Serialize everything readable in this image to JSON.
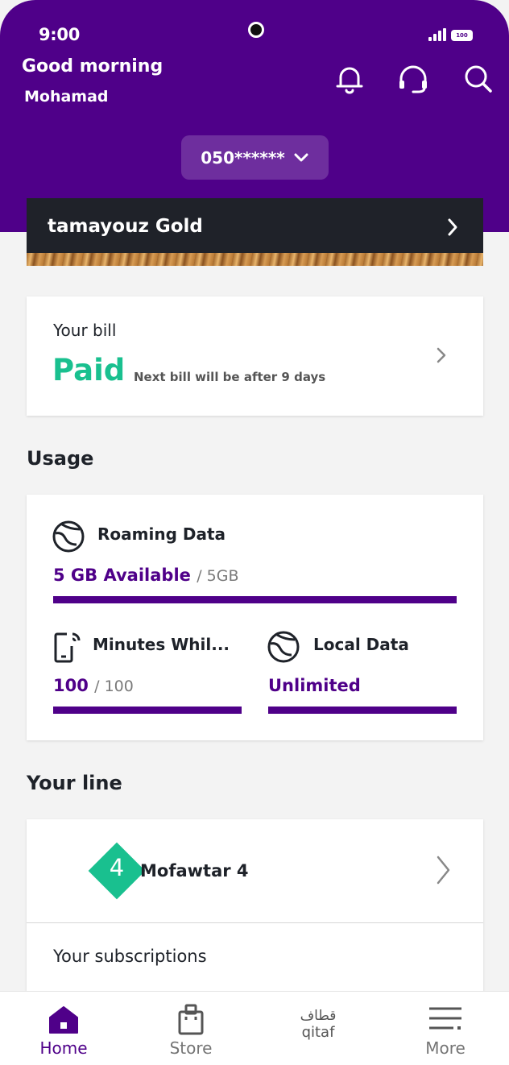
{
  "status_bar": {
    "time": "9:00",
    "battery": "100"
  },
  "header": {
    "greeting": "Good morning",
    "user_name": "Mohamad",
    "phone_number": "050******"
  },
  "tier": {
    "label": "tamayouz Gold"
  },
  "bill": {
    "title": "Your bill",
    "status": "Paid",
    "next_bill_note": "Next bill will be after 9 days"
  },
  "usage": {
    "section_title": "Usage",
    "roaming": {
      "title": "Roaming Data",
      "available": "5 GB Available",
      "total": "/ 5GB",
      "progress": 1.0
    },
    "minutes": {
      "title": "Minutes Whil...",
      "value": "100",
      "total": "/ 100",
      "progress": 1.0
    },
    "local": {
      "title": "Local Data",
      "value": "Unlimited",
      "progress": 1.0
    }
  },
  "line": {
    "section_title": "Your line",
    "plan_number": "4",
    "plan_name": "Mofawtar 4",
    "subscriptions_title": "Your subscriptions"
  },
  "tabbar": {
    "home": "Home",
    "store": "Store",
    "qitaf_arabic": "قطاف",
    "qitaf": "qitaf",
    "more": "More"
  },
  "colors": {
    "brand_purple": "#4f0089",
    "paid_green": "#19c08f",
    "dark_card": "#1f2229"
  }
}
